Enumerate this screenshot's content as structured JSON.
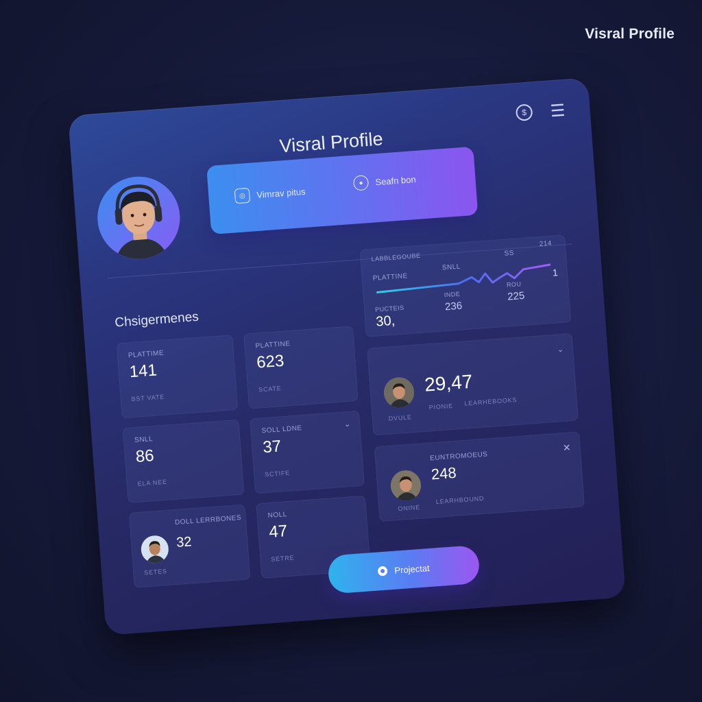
{
  "corner_title": "Visral Profile",
  "card": {
    "title": "Visral Profile",
    "icons": {
      "notify": "dollar-bell-icon",
      "menu": "hamburger-menu-icon"
    },
    "hero": {
      "left_button": {
        "label": "Vimrav pitus",
        "icon": "instagram-square-icon"
      },
      "right_button": {
        "label": "Seafn bon",
        "icon": "chat-bubble-icon"
      }
    },
    "section_label": "Chsigermenes",
    "tiles": [
      {
        "label": "PLATTIME",
        "value": "141",
        "sub": "BST VATE"
      },
      {
        "label": "PLATTINE",
        "value": "623",
        "sub": "SCATE"
      },
      {
        "label": "SNLL",
        "value": "86",
        "sub": "ELA NEE"
      },
      {
        "label": "SOLL LDNE",
        "value": "37",
        "sub": "SCTIFE"
      },
      {
        "label": "DOLL LERRBONES",
        "value": "32",
        "sub": "SETES"
      },
      {
        "label": "NOLL",
        "value": "47",
        "sub": "SETRE"
      }
    ],
    "chart_tile": {
      "label_top": "LABBLEGOUBE",
      "label_a": "PLATTINE",
      "label_b": "SNLL",
      "label_c": "SS",
      "label_d": "214",
      "label_e": "1",
      "stat_1_label": "PUCTEIS",
      "stat_1_value": "30,",
      "stat_2_label": "INDE",
      "stat_2_value": "236",
      "stat_3_label": "ROU",
      "stat_3_value": "225"
    },
    "big_tile_1": {
      "value": "29,47",
      "sub_a": "DVULE",
      "sub_b": "PIONIE",
      "sub_c": "LEARHEBOOKS"
    },
    "big_tile_2": {
      "label": "EUNTROMOEUS",
      "value": "248",
      "sub_a": "ONINE",
      "sub_b": "LEARHBOUND"
    },
    "cta_label": "Projectat"
  },
  "colors": {
    "accent_blue": "#3c8ef0",
    "accent_purple": "#8b55f0",
    "card_bg": "#272a66"
  }
}
